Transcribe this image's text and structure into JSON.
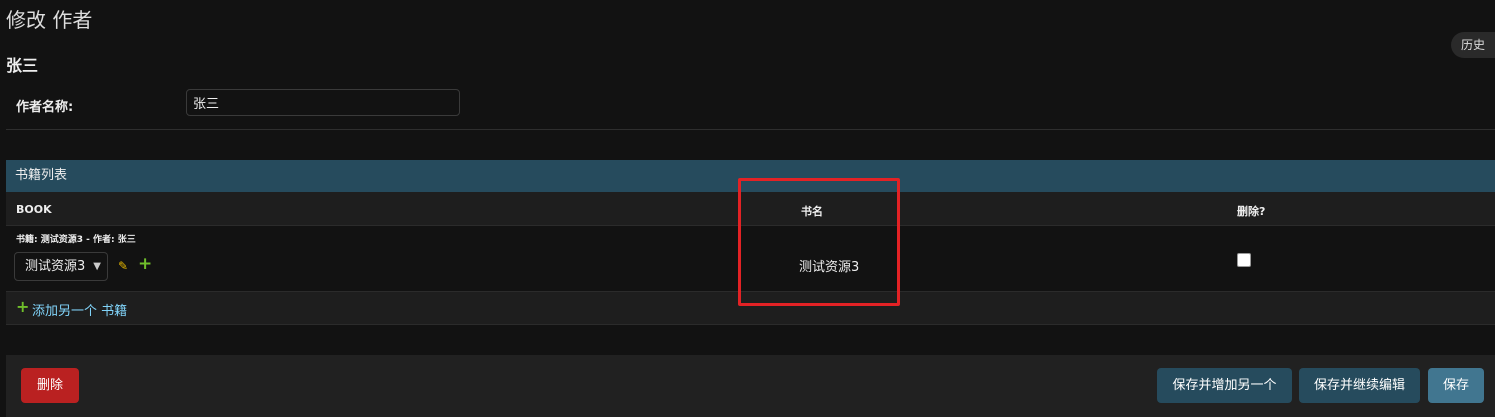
{
  "page": {
    "title": "修改 作者",
    "history_label": "历史",
    "object_name": "张三"
  },
  "form": {
    "author_name_label": "作者名称:",
    "author_name_value": "张三"
  },
  "inline": {
    "header": "书籍列表",
    "columns": {
      "book": "BOOK",
      "name": "书名",
      "delete": "删除?"
    },
    "rows": [
      {
        "original": "书籍: 测试资源3 - 作者: 张三",
        "selected_book": "测试资源3",
        "name": "测试资源3",
        "delete_checked": false
      }
    ],
    "add_another_label": "添加另一个 书籍"
  },
  "actions": {
    "delete_label": "删除",
    "save_add_another_label": "保存并增加另一个",
    "save_continue_label": "保存并继续编辑",
    "save_label": "保存"
  },
  "icons": {
    "edit": "pencil-icon",
    "add": "plus-icon",
    "select_arrow": "chevron-down-icon"
  },
  "colors": {
    "background": "#121212",
    "inline_header": "#264b5d",
    "delete_button": "#ba2121",
    "save_button": "#417690",
    "secondary_button": "#264b5d",
    "add_icon": "#70bf2b",
    "edit_icon": "#e6b800",
    "link": "#81d4fa",
    "highlight": "#e32225"
  }
}
